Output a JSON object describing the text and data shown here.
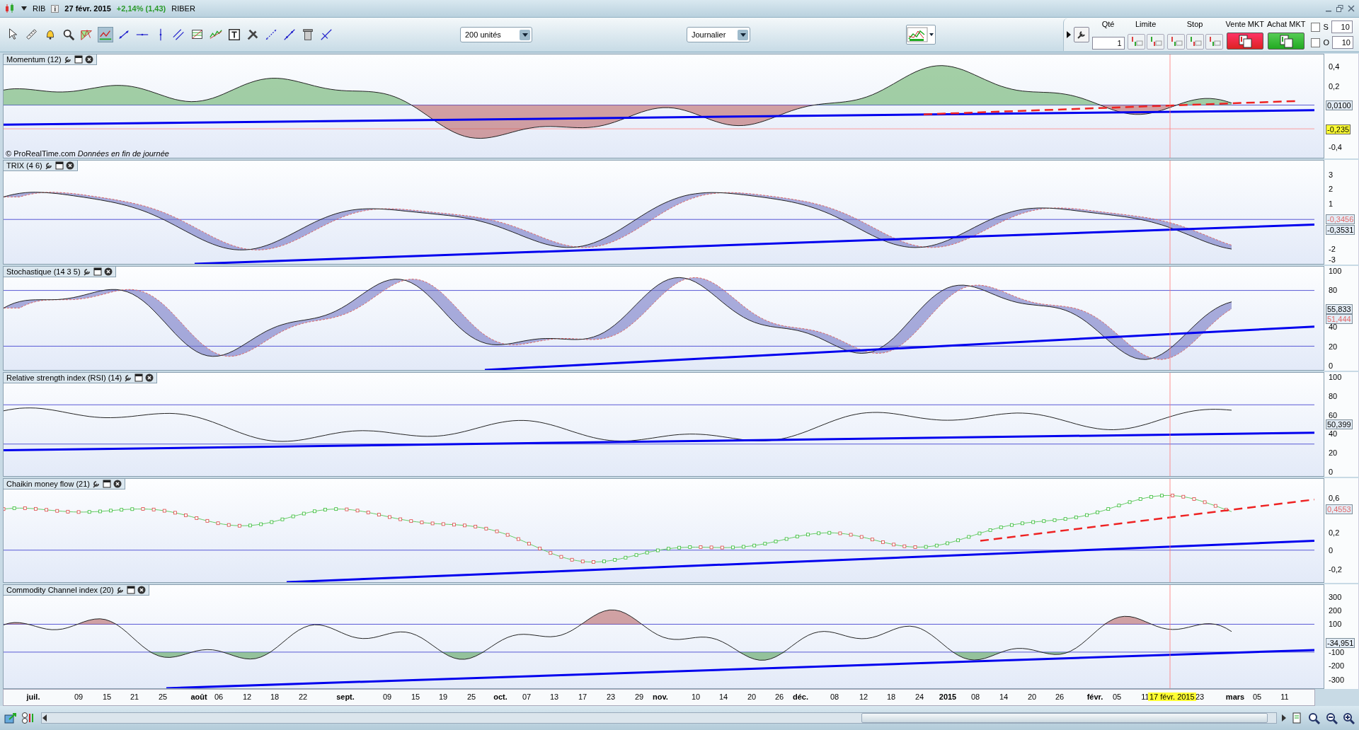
{
  "title_bar": {
    "symbol": "RIB",
    "date": "27 févr. 2015",
    "change": "+2,14% (1,43)",
    "name": "RIBER"
  },
  "toolbar": {
    "units": "200 unités",
    "period": "Journalier"
  },
  "order_panel": {
    "qty_label": "Qté",
    "qty": "1",
    "limit_label": "Limite",
    "stop_label": "Stop",
    "sell": "Vente MKT",
    "buy": "Achat MKT",
    "options": [
      {
        "label": "S",
        "value": "10",
        "checked": false
      },
      {
        "label": "O",
        "value": "10",
        "checked": false
      }
    ]
  },
  "panels": [
    {
      "kind": "momentum",
      "title": "Momentum (12)",
      "ticks": [
        "0,4",
        "0,2",
        "-0,4"
      ],
      "badges": [
        {
          "text": "0,0100",
          "kind": "current"
        },
        {
          "text": "-0,235",
          "kind": "highlight"
        }
      ],
      "note": "© ProRealTime.com",
      "note_italic": "Données en fin de journée"
    },
    {
      "kind": "trix",
      "title": "TRIX (4 6)",
      "ticks": [
        "3",
        "2",
        "1",
        "-2",
        "-3"
      ],
      "badges": [
        {
          "text": "-0,3456",
          "kind": "signal"
        },
        {
          "text": "-0,3531",
          "kind": "current"
        }
      ]
    },
    {
      "kind": "stochastic",
      "title": "Stochastique (14 3 5)",
      "ticks": [
        "100",
        "80",
        "40",
        "20",
        "0"
      ],
      "badges": [
        {
          "text": "55,833",
          "kind": "current"
        },
        {
          "text": "51,444",
          "kind": "signal"
        }
      ]
    },
    {
      "kind": "rsi",
      "title": "Relative strength index (RSI) (14)",
      "ticks": [
        "100",
        "80",
        "60",
        "40",
        "20",
        "0"
      ],
      "badges": [
        {
          "text": "50,399",
          "kind": "current"
        }
      ]
    },
    {
      "kind": "chaikin",
      "title": "Chaikin money flow (21)",
      "ticks": [
        "0,6",
        "0,2",
        "0",
        "-0,2"
      ],
      "badges": [
        {
          "text": "0,4553",
          "kind": "signal"
        }
      ]
    },
    {
      "kind": "cci",
      "title": "Commodity Channel index (20)",
      "ticks": [
        "300",
        "200",
        "100",
        "-100",
        "-200",
        "-300"
      ],
      "badges": [
        {
          "text": "-34,951",
          "kind": "current"
        }
      ]
    }
  ],
  "time_axis": [
    {
      "label": "juil.",
      "kind": "month"
    },
    {
      "label": "09",
      "kind": "day"
    },
    {
      "label": "15",
      "kind": "day"
    },
    {
      "label": "21",
      "kind": "day"
    },
    {
      "label": "25",
      "kind": "day"
    },
    {
      "label": "août",
      "kind": "month"
    },
    {
      "label": "06",
      "kind": "day"
    },
    {
      "label": "12",
      "kind": "day"
    },
    {
      "label": "18",
      "kind": "day"
    },
    {
      "label": "22",
      "kind": "day"
    },
    {
      "label": "sept.",
      "kind": "month"
    },
    {
      "label": "09",
      "kind": "day"
    },
    {
      "label": "15",
      "kind": "day"
    },
    {
      "label": "19",
      "kind": "day"
    },
    {
      "label": "25",
      "kind": "day"
    },
    {
      "label": "oct.",
      "kind": "month"
    },
    {
      "label": "07",
      "kind": "day"
    },
    {
      "label": "13",
      "kind": "day"
    },
    {
      "label": "17",
      "kind": "day"
    },
    {
      "label": "23",
      "kind": "day"
    },
    {
      "label": "29",
      "kind": "day"
    },
    {
      "label": "nov.",
      "kind": "month"
    },
    {
      "label": "10",
      "kind": "day"
    },
    {
      "label": "14",
      "kind": "day"
    },
    {
      "label": "20",
      "kind": "day"
    },
    {
      "label": "26",
      "kind": "day"
    },
    {
      "label": "déc.",
      "kind": "month"
    },
    {
      "label": "08",
      "kind": "day"
    },
    {
      "label": "12",
      "kind": "day"
    },
    {
      "label": "18",
      "kind": "day"
    },
    {
      "label": "24",
      "kind": "day"
    },
    {
      "label": "2015",
      "kind": "month"
    },
    {
      "label": "08",
      "kind": "day"
    },
    {
      "label": "14",
      "kind": "day"
    },
    {
      "label": "20",
      "kind": "day"
    },
    {
      "label": "26",
      "kind": "day"
    },
    {
      "label": "févr.",
      "kind": "month"
    },
    {
      "label": "05",
      "kind": "day"
    },
    {
      "label": "11",
      "kind": "day"
    },
    {
      "label": "17 févr. 2015",
      "kind": "cursor"
    },
    {
      "label": "23",
      "kind": "day"
    },
    {
      "label": "mars",
      "kind": "month"
    },
    {
      "label": "05",
      "kind": "day"
    },
    {
      "label": "11",
      "kind": "day"
    }
  ]
}
